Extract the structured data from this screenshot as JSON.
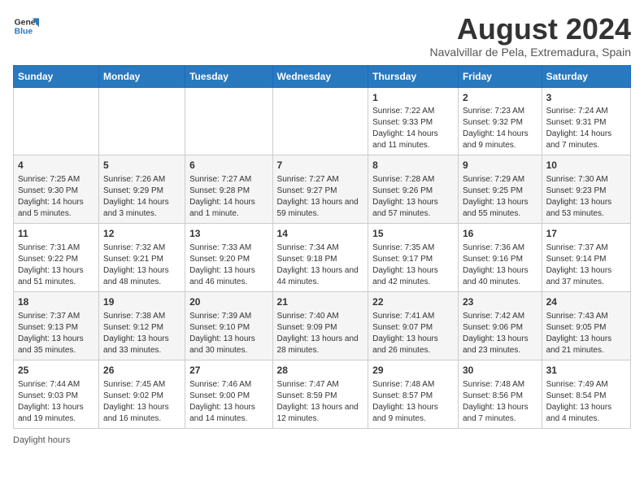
{
  "logo": {
    "line1": "General",
    "line2": "Blue"
  },
  "title": "August 2024",
  "subtitle": "Navalvillar de Pela, Extremadura, Spain",
  "headers": [
    "Sunday",
    "Monday",
    "Tuesday",
    "Wednesday",
    "Thursday",
    "Friday",
    "Saturday"
  ],
  "footer": "Daylight hours",
  "weeks": [
    [
      {
        "day": "",
        "info": ""
      },
      {
        "day": "",
        "info": ""
      },
      {
        "day": "",
        "info": ""
      },
      {
        "day": "",
        "info": ""
      },
      {
        "day": "1",
        "info": "Sunrise: 7:22 AM\nSunset: 9:33 PM\nDaylight: 14 hours and 11 minutes."
      },
      {
        "day": "2",
        "info": "Sunrise: 7:23 AM\nSunset: 9:32 PM\nDaylight: 14 hours and 9 minutes."
      },
      {
        "day": "3",
        "info": "Sunrise: 7:24 AM\nSunset: 9:31 PM\nDaylight: 14 hours and 7 minutes."
      }
    ],
    [
      {
        "day": "4",
        "info": "Sunrise: 7:25 AM\nSunset: 9:30 PM\nDaylight: 14 hours and 5 minutes."
      },
      {
        "day": "5",
        "info": "Sunrise: 7:26 AM\nSunset: 9:29 PM\nDaylight: 14 hours and 3 minutes."
      },
      {
        "day": "6",
        "info": "Sunrise: 7:27 AM\nSunset: 9:28 PM\nDaylight: 14 hours and 1 minute."
      },
      {
        "day": "7",
        "info": "Sunrise: 7:27 AM\nSunset: 9:27 PM\nDaylight: 13 hours and 59 minutes."
      },
      {
        "day": "8",
        "info": "Sunrise: 7:28 AM\nSunset: 9:26 PM\nDaylight: 13 hours and 57 minutes."
      },
      {
        "day": "9",
        "info": "Sunrise: 7:29 AM\nSunset: 9:25 PM\nDaylight: 13 hours and 55 minutes."
      },
      {
        "day": "10",
        "info": "Sunrise: 7:30 AM\nSunset: 9:23 PM\nDaylight: 13 hours and 53 minutes."
      }
    ],
    [
      {
        "day": "11",
        "info": "Sunrise: 7:31 AM\nSunset: 9:22 PM\nDaylight: 13 hours and 51 minutes."
      },
      {
        "day": "12",
        "info": "Sunrise: 7:32 AM\nSunset: 9:21 PM\nDaylight: 13 hours and 48 minutes."
      },
      {
        "day": "13",
        "info": "Sunrise: 7:33 AM\nSunset: 9:20 PM\nDaylight: 13 hours and 46 minutes."
      },
      {
        "day": "14",
        "info": "Sunrise: 7:34 AM\nSunset: 9:18 PM\nDaylight: 13 hours and 44 minutes."
      },
      {
        "day": "15",
        "info": "Sunrise: 7:35 AM\nSunset: 9:17 PM\nDaylight: 13 hours and 42 minutes."
      },
      {
        "day": "16",
        "info": "Sunrise: 7:36 AM\nSunset: 9:16 PM\nDaylight: 13 hours and 40 minutes."
      },
      {
        "day": "17",
        "info": "Sunrise: 7:37 AM\nSunset: 9:14 PM\nDaylight: 13 hours and 37 minutes."
      }
    ],
    [
      {
        "day": "18",
        "info": "Sunrise: 7:37 AM\nSunset: 9:13 PM\nDaylight: 13 hours and 35 minutes."
      },
      {
        "day": "19",
        "info": "Sunrise: 7:38 AM\nSunset: 9:12 PM\nDaylight: 13 hours and 33 minutes."
      },
      {
        "day": "20",
        "info": "Sunrise: 7:39 AM\nSunset: 9:10 PM\nDaylight: 13 hours and 30 minutes."
      },
      {
        "day": "21",
        "info": "Sunrise: 7:40 AM\nSunset: 9:09 PM\nDaylight: 13 hours and 28 minutes."
      },
      {
        "day": "22",
        "info": "Sunrise: 7:41 AM\nSunset: 9:07 PM\nDaylight: 13 hours and 26 minutes."
      },
      {
        "day": "23",
        "info": "Sunrise: 7:42 AM\nSunset: 9:06 PM\nDaylight: 13 hours and 23 minutes."
      },
      {
        "day": "24",
        "info": "Sunrise: 7:43 AM\nSunset: 9:05 PM\nDaylight: 13 hours and 21 minutes."
      }
    ],
    [
      {
        "day": "25",
        "info": "Sunrise: 7:44 AM\nSunset: 9:03 PM\nDaylight: 13 hours and 19 minutes."
      },
      {
        "day": "26",
        "info": "Sunrise: 7:45 AM\nSunset: 9:02 PM\nDaylight: 13 hours and 16 minutes."
      },
      {
        "day": "27",
        "info": "Sunrise: 7:46 AM\nSunset: 9:00 PM\nDaylight: 13 hours and 14 minutes."
      },
      {
        "day": "28",
        "info": "Sunrise: 7:47 AM\nSunset: 8:59 PM\nDaylight: 13 hours and 12 minutes."
      },
      {
        "day": "29",
        "info": "Sunrise: 7:48 AM\nSunset: 8:57 PM\nDaylight: 13 hours and 9 minutes."
      },
      {
        "day": "30",
        "info": "Sunrise: 7:48 AM\nSunset: 8:56 PM\nDaylight: 13 hours and 7 minutes."
      },
      {
        "day": "31",
        "info": "Sunrise: 7:49 AM\nSunset: 8:54 PM\nDaylight: 13 hours and 4 minutes."
      }
    ]
  ]
}
